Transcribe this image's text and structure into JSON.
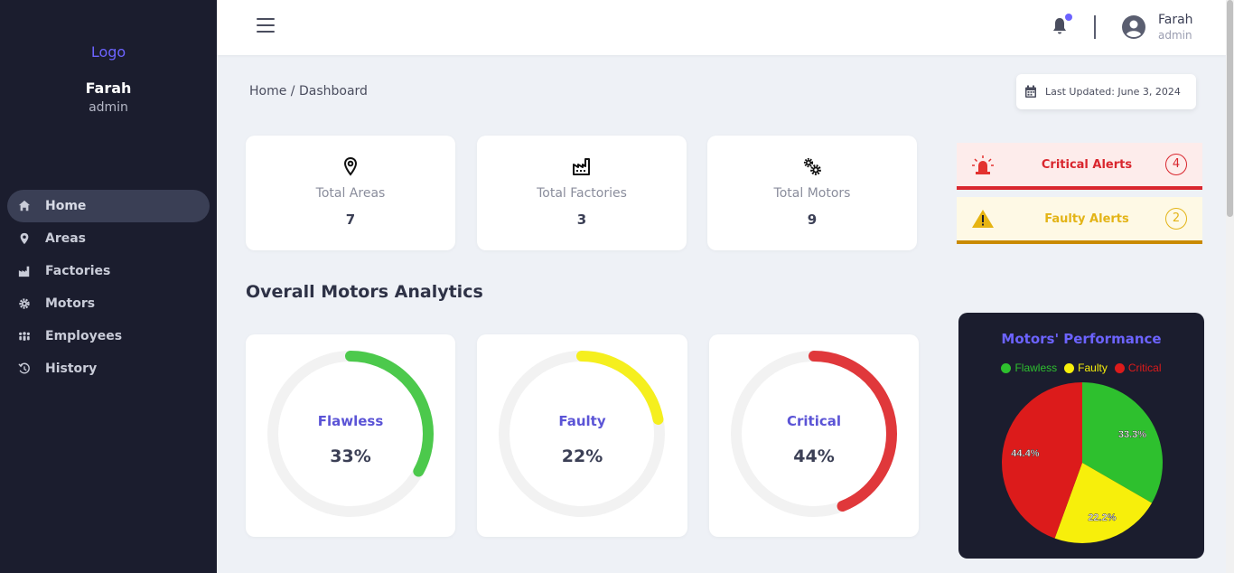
{
  "sidebar": {
    "logo": "Logo",
    "user_name": "Farah",
    "user_role": "admin",
    "items": [
      {
        "label": "Home",
        "icon": "home-icon",
        "active": true
      },
      {
        "label": "Areas",
        "icon": "map-pin-icon",
        "active": false
      },
      {
        "label": "Factories",
        "icon": "factory-icon",
        "active": false
      },
      {
        "label": "Motors",
        "icon": "gear-icon",
        "active": false
      },
      {
        "label": "Employees",
        "icon": "users-icon",
        "active": false
      },
      {
        "label": "History",
        "icon": "history-icon",
        "active": false
      }
    ]
  },
  "topbar": {
    "user_name": "Farah",
    "user_role": "admin"
  },
  "breadcrumb": {
    "home": "Home",
    "separator": "/",
    "current": "Dashboard"
  },
  "last_updated": "Last Updated: June 3, 2024",
  "stats": [
    {
      "label": "Total Areas",
      "value": "7",
      "icon": "map-pin-icon"
    },
    {
      "label": "Total Factories",
      "value": "3",
      "icon": "factory-icon"
    },
    {
      "label": "Total Motors",
      "value": "9",
      "icon": "gears-icon"
    }
  ],
  "alerts": {
    "critical": {
      "label": "Critical Alerts",
      "count": "4",
      "color": "#d9262e"
    },
    "faulty": {
      "label": "Faulty Alerts",
      "count": "2",
      "color": "#e3b417"
    }
  },
  "section_title": "Overall Motors Analytics",
  "gauges": [
    {
      "label": "Flawless",
      "value_text": "33%",
      "fraction": 0.33,
      "color": "#4cc94c"
    },
    {
      "label": "Faulty",
      "value_text": "22%",
      "fraction": 0.22,
      "color": "#f5ef1e"
    },
    {
      "label": "Critical",
      "value_text": "44%",
      "fraction": 0.44,
      "color": "#e0383b"
    }
  ],
  "chart_data": {
    "type": "pie",
    "title": "Motors' Performance",
    "legend_position": "top",
    "categories": [
      "Flawless",
      "Faulty",
      "Critical"
    ],
    "values": [
      33.3,
      22.2,
      44.4
    ],
    "labels": [
      "33.3%",
      "22.2%",
      "44.4%"
    ],
    "colors": [
      "#2ec02e",
      "#f7ef0b",
      "#dc1b1b"
    ]
  }
}
